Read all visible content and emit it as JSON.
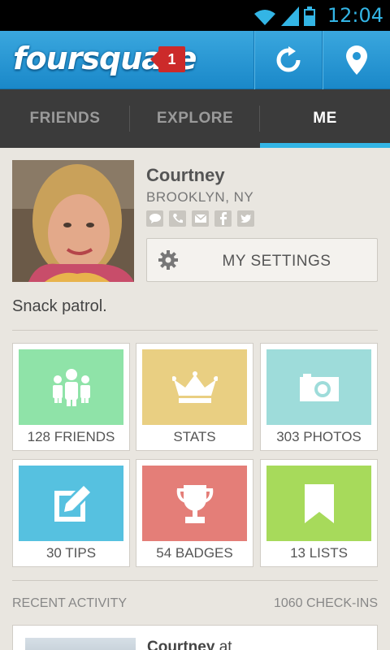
{
  "status_bar": {
    "time": "12:04"
  },
  "header": {
    "logo": "foursquare",
    "notification_count": "1"
  },
  "tabs": [
    {
      "label": "FRIENDS"
    },
    {
      "label": "EXPLORE"
    },
    {
      "label": "ME",
      "active": true
    }
  ],
  "profile": {
    "name": "Courtney",
    "location": "BROOKLYN, NY",
    "contact_icons": [
      "message-icon",
      "phone-icon",
      "mail-icon",
      "facebook-icon",
      "twitter-icon"
    ],
    "settings_label": "MY SETTINGS",
    "bio": "Snack patrol."
  },
  "tiles": [
    {
      "label": "128 FRIENDS",
      "icon": "friends-icon",
      "color": "#8fe3a8"
    },
    {
      "label": "STATS",
      "icon": "crown-icon",
      "color": "#e9cf82"
    },
    {
      "label": "303 PHOTOS",
      "icon": "camera-icon",
      "color": "#9edcda"
    },
    {
      "label": "30 TIPS",
      "icon": "edit-icon",
      "color": "#56c1e0"
    },
    {
      "label": "54 BADGES",
      "icon": "trophy-icon",
      "color": "#e47e78"
    },
    {
      "label": "13 LISTS",
      "icon": "bookmark-icon",
      "color": "#a7da5b"
    }
  ],
  "recent_activity": {
    "title": "RECENT ACTIVITY",
    "checkins": "1060 CHECK-INS",
    "item": {
      "user": "Courtney",
      "text": "at"
    }
  }
}
